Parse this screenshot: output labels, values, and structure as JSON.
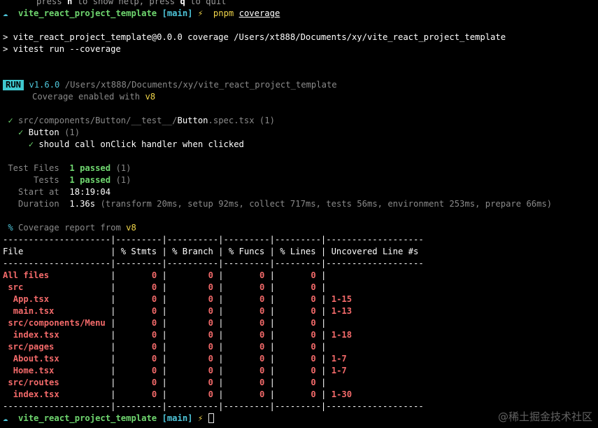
{
  "top_hint": {
    "press": "press ",
    "h_key": "h",
    "help_mid": " to show help, press ",
    "q_key": "q",
    "quit": " to quit"
  },
  "prompt": {
    "arrow": "☁",
    "project": "vite_react_project_template",
    "branch": "[main]",
    "bolt": "⚡",
    "cmd": "pnpm",
    "arg": "coverage"
  },
  "script_lines": [
    "> vite_react_project_template@0.0.0 coverage /Users/xt888/Documents/xy/vite_react_project_template",
    "> vitest run --coverage"
  ],
  "run": {
    "badge": "RUN",
    "version": "v1.6.0",
    "path": "/Users/xt888/Documents/xy/vite_react_project_template",
    "coverage_label": "Coverage enabled with ",
    "coverage_provider": "v8"
  },
  "spec": {
    "check": "✓",
    "path_prefix": "src/components/Button/__test__/",
    "file": "Button",
    "suffix": ".spec.tsx",
    "count": "(1)",
    "suite": "Button",
    "suite_count": "(1)",
    "test": "should call onClick handler when clicked"
  },
  "summary": {
    "files_label": "Test Files",
    "files_value": "1 passed",
    "files_count": "(1)",
    "tests_label": "Tests",
    "tests_value": "1 passed",
    "tests_count": "(1)",
    "start_label": "Start at",
    "start_value": "18:19:04",
    "duration_label": "Duration",
    "duration_value": "1.36s",
    "duration_detail": "(transform 20ms, setup 92ms, collect 717ms, tests 56ms, environment 253ms, prepare 66ms)"
  },
  "coverage_report": {
    "percent": "%",
    "label": "Coverage report from ",
    "provider": "v8"
  },
  "table": {
    "separator": "---------------------|---------|----------|---------|---------|-------------------",
    "header": "File                 | % Stmts | % Branch | % Funcs | % Lines | Uncovered Line #s ",
    "rows": [
      {
        "name": "All files",
        "indent": 0,
        "stmts": "0",
        "branch": "0",
        "funcs": "0",
        "lines": "0",
        "uncovered": ""
      },
      {
        "name": "src",
        "indent": 1,
        "stmts": "0",
        "branch": "0",
        "funcs": "0",
        "lines": "0",
        "uncovered": ""
      },
      {
        "name": "App.tsx",
        "indent": 2,
        "stmts": "0",
        "branch": "0",
        "funcs": "0",
        "lines": "0",
        "uncovered": "1-15"
      },
      {
        "name": "main.tsx",
        "indent": 2,
        "stmts": "0",
        "branch": "0",
        "funcs": "0",
        "lines": "0",
        "uncovered": "1-13"
      },
      {
        "name": "src/components/Menu",
        "indent": 1,
        "stmts": "0",
        "branch": "0",
        "funcs": "0",
        "lines": "0",
        "uncovered": ""
      },
      {
        "name": "index.tsx",
        "indent": 2,
        "stmts": "0",
        "branch": "0",
        "funcs": "0",
        "lines": "0",
        "uncovered": "1-18"
      },
      {
        "name": "src/pages",
        "indent": 1,
        "stmts": "0",
        "branch": "0",
        "funcs": "0",
        "lines": "0",
        "uncovered": ""
      },
      {
        "name": "About.tsx",
        "indent": 2,
        "stmts": "0",
        "branch": "0",
        "funcs": "0",
        "lines": "0",
        "uncovered": "1-7"
      },
      {
        "name": "Home.tsx",
        "indent": 2,
        "stmts": "0",
        "branch": "0",
        "funcs": "0",
        "lines": "0",
        "uncovered": "1-7"
      },
      {
        "name": "src/routes",
        "indent": 1,
        "stmts": "0",
        "branch": "0",
        "funcs": "0",
        "lines": "0",
        "uncovered": ""
      },
      {
        "name": "index.tsx",
        "indent": 2,
        "stmts": "0",
        "branch": "0",
        "funcs": "0",
        "lines": "0",
        "uncovered": "1-30"
      }
    ]
  },
  "watermark": "@稀土掘金技术社区",
  "colors": {
    "background": "#000000",
    "green": "#6fd66f",
    "yellow": "#f1d64a",
    "cyan": "#4ec5d9",
    "red": "#f36a6a"
  }
}
